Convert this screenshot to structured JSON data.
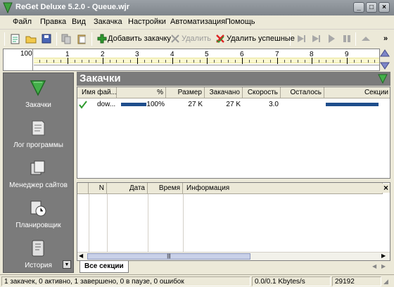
{
  "window": {
    "title": "ReGet Deluxe 5.2.0 - Queue.wjr",
    "controls": {
      "minimize": "_",
      "maximize": "□",
      "close": "×"
    }
  },
  "menu": [
    "Файл",
    "Правка",
    "Вид",
    "Закачка",
    "Настройки",
    "Автоматизация",
    "Помощь"
  ],
  "toolbar": {
    "add_label": "Добавить закачку",
    "delete_label": "Удалить",
    "delete_success_label": "Удалить успешные",
    "more": "»"
  },
  "ruler": {
    "left_value": "100",
    "numbers": [
      "1",
      "2",
      "3",
      "4",
      "5",
      "6",
      "7",
      "8",
      "9"
    ]
  },
  "sidebar": {
    "items": [
      {
        "label": "Закачки",
        "icon": "downloads-icon"
      },
      {
        "label": "Лог программы",
        "icon": "log-icon"
      },
      {
        "label": "Менеджер сайтов",
        "icon": "site-manager-icon"
      },
      {
        "label": "Планировщик",
        "icon": "scheduler-icon"
      },
      {
        "label": "История",
        "icon": "history-icon"
      }
    ]
  },
  "panel": {
    "title": "Закачки"
  },
  "downloads": {
    "columns": [
      "Имя фай...",
      "%",
      "Размер",
      "Закачано",
      "Скорость",
      "Осталось",
      "Секции"
    ],
    "rows": [
      {
        "name": "dow...",
        "progress": 100,
        "percent": "100%",
        "size": "27 K",
        "downloaded": "27 K",
        "speed": "3.0",
        "remaining": ""
      }
    ]
  },
  "log": {
    "columns": [
      "N",
      "Дата",
      "Время",
      "Информация"
    ],
    "close": "×",
    "scroll_grip": "|||"
  },
  "tabs": {
    "active": "Все секции"
  },
  "status": {
    "summary": "1 закачек, 0 активно, 1 завершено, 0 в паузе, 0 ошибок",
    "speed": "0.0/0.1 Kbytes/s",
    "number": "29192"
  },
  "colors": {
    "accent_green": "#2f9a2f",
    "progress_blue": "#1f4e8c",
    "sidebar_gray": "#7b7b7b"
  }
}
